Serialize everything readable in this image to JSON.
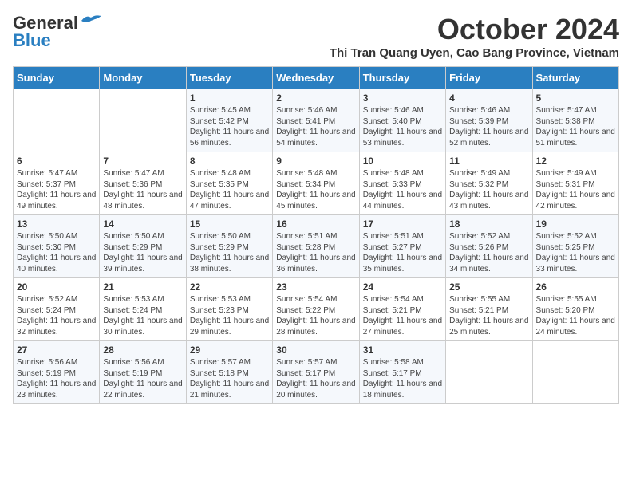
{
  "header": {
    "logo_line1": "General",
    "logo_line2": "Blue",
    "month_title": "October 2024",
    "subtitle": "Thi Tran Quang Uyen, Cao Bang Province, Vietnam"
  },
  "days_of_week": [
    "Sunday",
    "Monday",
    "Tuesday",
    "Wednesday",
    "Thursday",
    "Friday",
    "Saturday"
  ],
  "weeks": [
    [
      {
        "day": "",
        "content": ""
      },
      {
        "day": "",
        "content": ""
      },
      {
        "day": "1",
        "content": "Sunrise: 5:45 AM\nSunset: 5:42 PM\nDaylight: 11 hours and 56 minutes."
      },
      {
        "day": "2",
        "content": "Sunrise: 5:46 AM\nSunset: 5:41 PM\nDaylight: 11 hours and 54 minutes."
      },
      {
        "day": "3",
        "content": "Sunrise: 5:46 AM\nSunset: 5:40 PM\nDaylight: 11 hours and 53 minutes."
      },
      {
        "day": "4",
        "content": "Sunrise: 5:46 AM\nSunset: 5:39 PM\nDaylight: 11 hours and 52 minutes."
      },
      {
        "day": "5",
        "content": "Sunrise: 5:47 AM\nSunset: 5:38 PM\nDaylight: 11 hours and 51 minutes."
      }
    ],
    [
      {
        "day": "6",
        "content": "Sunrise: 5:47 AM\nSunset: 5:37 PM\nDaylight: 11 hours and 49 minutes."
      },
      {
        "day": "7",
        "content": "Sunrise: 5:47 AM\nSunset: 5:36 PM\nDaylight: 11 hours and 48 minutes."
      },
      {
        "day": "8",
        "content": "Sunrise: 5:48 AM\nSunset: 5:35 PM\nDaylight: 11 hours and 47 minutes."
      },
      {
        "day": "9",
        "content": "Sunrise: 5:48 AM\nSunset: 5:34 PM\nDaylight: 11 hours and 45 minutes."
      },
      {
        "day": "10",
        "content": "Sunrise: 5:48 AM\nSunset: 5:33 PM\nDaylight: 11 hours and 44 minutes."
      },
      {
        "day": "11",
        "content": "Sunrise: 5:49 AM\nSunset: 5:32 PM\nDaylight: 11 hours and 43 minutes."
      },
      {
        "day": "12",
        "content": "Sunrise: 5:49 AM\nSunset: 5:31 PM\nDaylight: 11 hours and 42 minutes."
      }
    ],
    [
      {
        "day": "13",
        "content": "Sunrise: 5:50 AM\nSunset: 5:30 PM\nDaylight: 11 hours and 40 minutes."
      },
      {
        "day": "14",
        "content": "Sunrise: 5:50 AM\nSunset: 5:29 PM\nDaylight: 11 hours and 39 minutes."
      },
      {
        "day": "15",
        "content": "Sunrise: 5:50 AM\nSunset: 5:29 PM\nDaylight: 11 hours and 38 minutes."
      },
      {
        "day": "16",
        "content": "Sunrise: 5:51 AM\nSunset: 5:28 PM\nDaylight: 11 hours and 36 minutes."
      },
      {
        "day": "17",
        "content": "Sunrise: 5:51 AM\nSunset: 5:27 PM\nDaylight: 11 hours and 35 minutes."
      },
      {
        "day": "18",
        "content": "Sunrise: 5:52 AM\nSunset: 5:26 PM\nDaylight: 11 hours and 34 minutes."
      },
      {
        "day": "19",
        "content": "Sunrise: 5:52 AM\nSunset: 5:25 PM\nDaylight: 11 hours and 33 minutes."
      }
    ],
    [
      {
        "day": "20",
        "content": "Sunrise: 5:52 AM\nSunset: 5:24 PM\nDaylight: 11 hours and 32 minutes."
      },
      {
        "day": "21",
        "content": "Sunrise: 5:53 AM\nSunset: 5:24 PM\nDaylight: 11 hours and 30 minutes."
      },
      {
        "day": "22",
        "content": "Sunrise: 5:53 AM\nSunset: 5:23 PM\nDaylight: 11 hours and 29 minutes."
      },
      {
        "day": "23",
        "content": "Sunrise: 5:54 AM\nSunset: 5:22 PM\nDaylight: 11 hours and 28 minutes."
      },
      {
        "day": "24",
        "content": "Sunrise: 5:54 AM\nSunset: 5:21 PM\nDaylight: 11 hours and 27 minutes."
      },
      {
        "day": "25",
        "content": "Sunrise: 5:55 AM\nSunset: 5:21 PM\nDaylight: 11 hours and 25 minutes."
      },
      {
        "day": "26",
        "content": "Sunrise: 5:55 AM\nSunset: 5:20 PM\nDaylight: 11 hours and 24 minutes."
      }
    ],
    [
      {
        "day": "27",
        "content": "Sunrise: 5:56 AM\nSunset: 5:19 PM\nDaylight: 11 hours and 23 minutes."
      },
      {
        "day": "28",
        "content": "Sunrise: 5:56 AM\nSunset: 5:19 PM\nDaylight: 11 hours and 22 minutes."
      },
      {
        "day": "29",
        "content": "Sunrise: 5:57 AM\nSunset: 5:18 PM\nDaylight: 11 hours and 21 minutes."
      },
      {
        "day": "30",
        "content": "Sunrise: 5:57 AM\nSunset: 5:17 PM\nDaylight: 11 hours and 20 minutes."
      },
      {
        "day": "31",
        "content": "Sunrise: 5:58 AM\nSunset: 5:17 PM\nDaylight: 11 hours and 18 minutes."
      },
      {
        "day": "",
        "content": ""
      },
      {
        "day": "",
        "content": ""
      }
    ]
  ]
}
